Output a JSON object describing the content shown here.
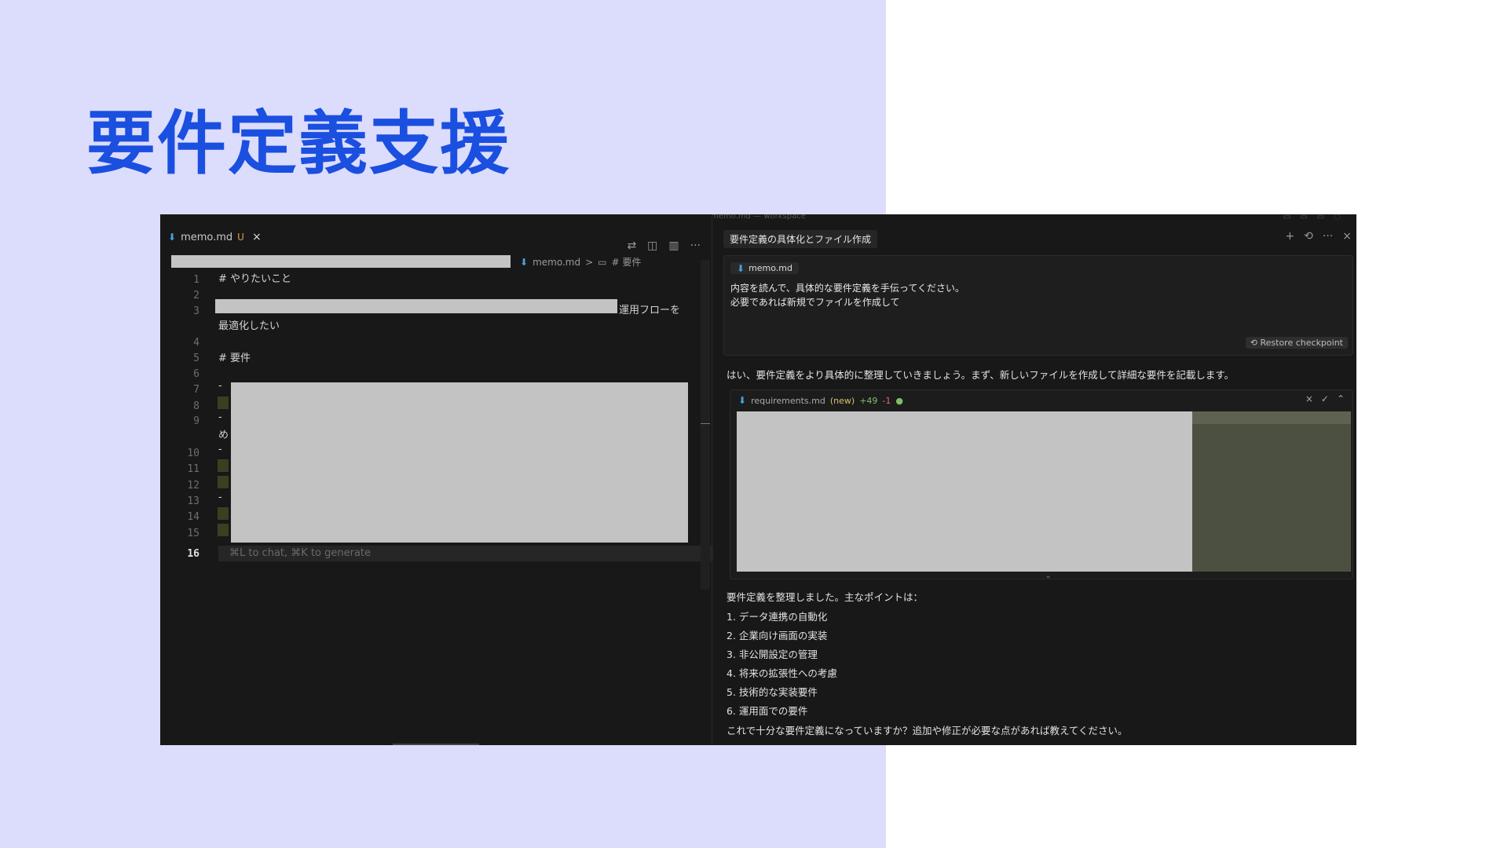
{
  "slide": {
    "title": "要件定義支援"
  },
  "window": {
    "title": "memo.md — workspace"
  },
  "editor": {
    "tab": {
      "name": "memo.md",
      "modified": "U",
      "close": "×"
    },
    "actions": [
      "⇄",
      "◫",
      "▥",
      "···"
    ],
    "breadcrumb": {
      "file": "memo.md",
      "separator": ">",
      "symbol_icon": "▭",
      "section": "# 要件"
    },
    "line_numbers": [
      "1",
      "2",
      "3",
      "4",
      "5",
      "6",
      "7",
      "8",
      "9",
      "10",
      "11",
      "12",
      "13",
      "14",
      "15",
      "16"
    ],
    "current_line": "16",
    "lines": {
      "l1": "# やりたいこと",
      "l3_tail": "運用フローを",
      "l3_wrap": "最適化したい",
      "l5": "# 要件",
      "l7": "-",
      "l9": "-",
      "l9_wrap": "め",
      "l10": "-",
      "l13": "-"
    },
    "hint": "⌘L to chat, ⌘K to generate"
  },
  "chat": {
    "title": "要件定義の具体化とファイル作成",
    "actions": [
      "+",
      "⟲",
      "···",
      "×"
    ],
    "user_message": {
      "file_chip": "memo.md",
      "line1": "内容を読んで、具体的な要件定義を手伝ってください。",
      "line2": "必要であれば新規でファイルを作成して",
      "restore": "⟲ Restore checkpoint"
    },
    "assistant_intro": "はい、要件定義をより具体的に整理していきましょう。まず、新しいファイルを作成して詳細な要件を記載します。",
    "diff": {
      "file": "requirements.md",
      "new": "(new)",
      "added": "+49",
      "removed": "-1",
      "dot": "●",
      "actions": [
        "×",
        "✓",
        "⌃"
      ]
    },
    "summary": "要件定義を整理しました。主なポイントは：",
    "points": [
      "1. データ連携の自動化",
      "2. 企業向け画面の実装",
      "3. 非公開設定の管理",
      "4. 将来の拡張性への考慮",
      "5. 技術的な実装要件",
      "6. 運用面での要件"
    ],
    "closing": "これで十分な要件定義になっていますか？追加や修正が必要な点があれば教えてください。"
  }
}
